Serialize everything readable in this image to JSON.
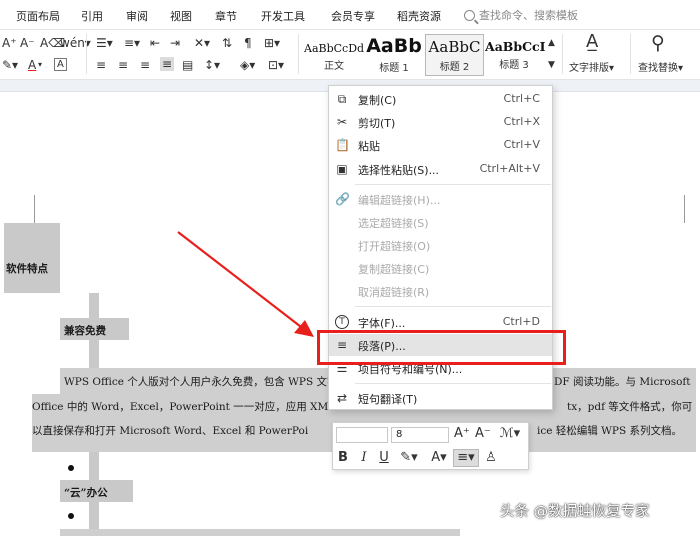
{
  "menu_tabs": [
    "页面布局",
    "引用",
    "审阅",
    "视图",
    "章节",
    "开发工具",
    "会员专享",
    "稻壳资源"
  ],
  "search_placeholder": "查找命令、搜索模板",
  "styles": [
    {
      "preview": "AaBbCcDd",
      "name": "正文"
    },
    {
      "preview": "AaBb",
      "name": "标题 1"
    },
    {
      "preview": "AaBbC",
      "name": "标题 2"
    },
    {
      "preview": "AaBbCcI",
      "name": "标题 3"
    }
  ],
  "ribbon_buttons": {
    "text_layout": "文字排版",
    "find_replace": "查找替换"
  },
  "document": {
    "heading": "软件特点",
    "sub1": "兼容免费",
    "para1_line1_a": "WPS Office 个人版对个人用户永久免费，包含 WPS 文字",
    "para1_line1_b": "DF 阅读功能。与 Microsoft",
    "para1_line2_a": "Office 中的 Word，Excel，PowerPoint 一一对应，应用 XM",
    "para1_line2_b": "tx，pdf 等文件格式，你可",
    "para1_line3_a": "以直接保存和打开  Microsoft Word、Excel 和  PowerPoi",
    "para1_line3_b": "ice 轻松编辑 WPS 系列文档。",
    "sub2": "“云”办公"
  },
  "context_menu": {
    "copy": {
      "label": "复制(C)",
      "shortcut": "Ctrl+C"
    },
    "cut": {
      "label": "剪切(T)",
      "shortcut": "Ctrl+X"
    },
    "paste": {
      "label": "粘贴",
      "shortcut": "Ctrl+V"
    },
    "paste_special": {
      "label": "选择性粘贴(S)...",
      "shortcut": "Ctrl+Alt+V"
    },
    "edit_link": {
      "label": "编辑超链接(H)..."
    },
    "select_link": {
      "label": "选定超链接(S)"
    },
    "open_link": {
      "label": "打开超链接(O)"
    },
    "copy_link": {
      "label": "复制超链接(C)"
    },
    "remove_link": {
      "label": "取消超链接(R)"
    },
    "font": {
      "label": "字体(F)...",
      "shortcut": "Ctrl+D"
    },
    "paragraph": {
      "label": "段落(P)..."
    },
    "bullets": {
      "label": "项目符号和编号(N)..."
    },
    "translate": {
      "label": "短句翻译(T)"
    }
  },
  "mini_toolbar": {
    "font_name": "",
    "font_size": "8"
  },
  "watermark": "头条 @数据蛙恢复专家",
  "colors": {
    "highlight_red": "#e8201c",
    "menu_hover": "#e4e4e4",
    "selection_gray": "#cfcfcf"
  }
}
